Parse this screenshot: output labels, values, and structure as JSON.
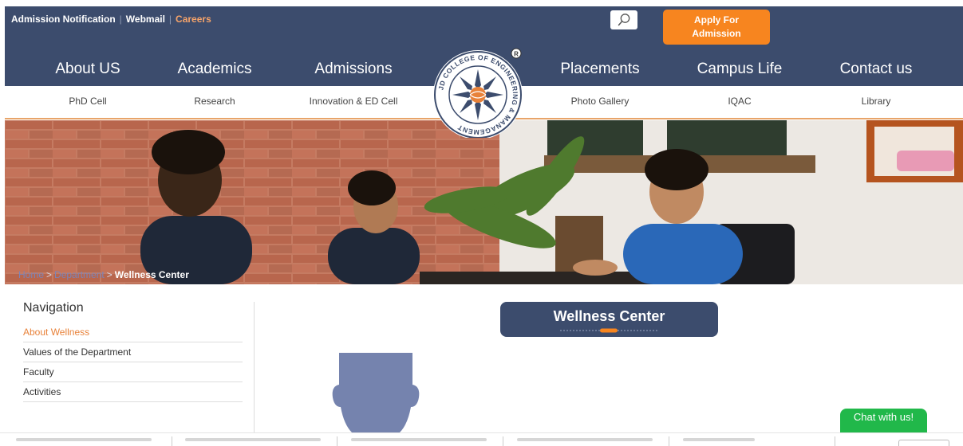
{
  "topbar": {
    "links": [
      "Admission Notification",
      "Webmail",
      "Careers"
    ],
    "apply_line1": "Apply For",
    "apply_line2": "Admission"
  },
  "mainnav": [
    "About US",
    "Academics",
    "Admissions",
    "Placements",
    "Campus Life",
    "Contact us"
  ],
  "subnav": [
    "PhD Cell",
    "Research",
    "Innovation & ED Cell",
    "Photo Gallery",
    "IQAC",
    "Library"
  ],
  "logo": {
    "text": "JD COLLEGE OF ENGINEERING & MANAGEMENT",
    "registered": "R"
  },
  "breadcrumb": {
    "home": "Home",
    "department": "Department",
    "separator": ">",
    "current": "Wellness Center"
  },
  "navigation": {
    "title": "Navigation",
    "items": [
      "About Wellness",
      "Values of the Department",
      "Faculty",
      "Activities"
    ],
    "active_index": 0
  },
  "page_title": "Wellness Center",
  "chat_label": "Chat with us!",
  "colors": {
    "navy": "#3c4c6d",
    "orange": "#f7851f",
    "accent_orange": "#e8823a",
    "chat_green": "#21b84a"
  },
  "icons": {
    "search": "search-icon",
    "avatar": "user-placeholder-icon"
  }
}
